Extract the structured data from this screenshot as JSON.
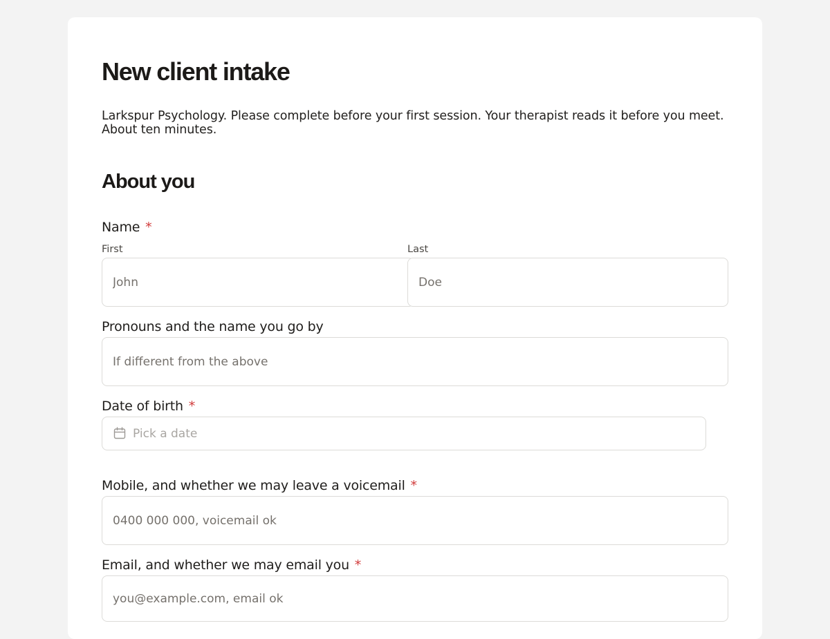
{
  "header": {
    "title": "New client intake",
    "intro": "Larkspur Psychology. Please complete before your first session. Your therapist reads it before you meet. About ten minutes."
  },
  "section": {
    "title": "About you"
  },
  "fields": {
    "name": {
      "label": "Name",
      "required_mark": "*",
      "first_label": "First",
      "first_placeholder": "John",
      "last_label": "Last",
      "last_placeholder": "Doe"
    },
    "pronouns": {
      "label": "Pronouns and the name you go by",
      "placeholder": "If different from the above"
    },
    "dob": {
      "label": "Date of birth",
      "required_mark": "*",
      "placeholder": "Pick a date",
      "icon": "calendar-icon"
    },
    "mobile": {
      "label": "Mobile, and whether we may leave a voicemail",
      "required_mark": "*",
      "placeholder": "0400 000 000, voicemail ok"
    },
    "email": {
      "label": "Email, and whether we may email you",
      "required_mark": "*",
      "placeholder": "you@example.com, email ok"
    }
  },
  "colors": {
    "background": "#f3f3f3",
    "card": "#ffffff",
    "required": "#d13b3b",
    "border": "#dcdbd8"
  }
}
